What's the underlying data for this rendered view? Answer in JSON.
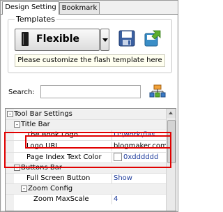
{
  "tabs": [
    {
      "label": "Design Setting"
    },
    {
      "label": "Bookmark"
    }
  ],
  "templates": {
    "group_title": "Templates",
    "selected": "Flexible",
    "hint": "Please customize the flash template here",
    "save_icon": "save-disk-icon",
    "export_icon": "export-arrow-icon"
  },
  "search": {
    "label": "Search:",
    "value": "",
    "tree_icon": "tree-structure-icon"
  },
  "grid": {
    "rows": [
      {
        "name": "Tool Bar Settings",
        "value": "",
        "type": "category",
        "expander": "-"
      },
      {
        "name": "Title Bar",
        "value": "",
        "type": "category",
        "expander": "-"
      },
      {
        "name": "The Book Logo",
        "value": "D:\\work\\flas...",
        "type": "property"
      },
      {
        "name": "Logo URL",
        "value": "blogmaker.com/",
        "type": "property"
      },
      {
        "name": "Page Index Text Color",
        "value": "0xdddddd",
        "type": "color"
      },
      {
        "name": "Buttons Bar",
        "value": "",
        "type": "category",
        "expander": "-"
      },
      {
        "name": "Full Screen Button",
        "value": "Show",
        "type": "property"
      },
      {
        "name": "Zoom Config",
        "value": "",
        "type": "category",
        "expander": "-"
      },
      {
        "name": "Zoom MaxScale",
        "value": "4",
        "type": "property"
      }
    ]
  },
  "colors": {
    "highlight": "#e00000",
    "value_text": "#1f3c9c"
  }
}
